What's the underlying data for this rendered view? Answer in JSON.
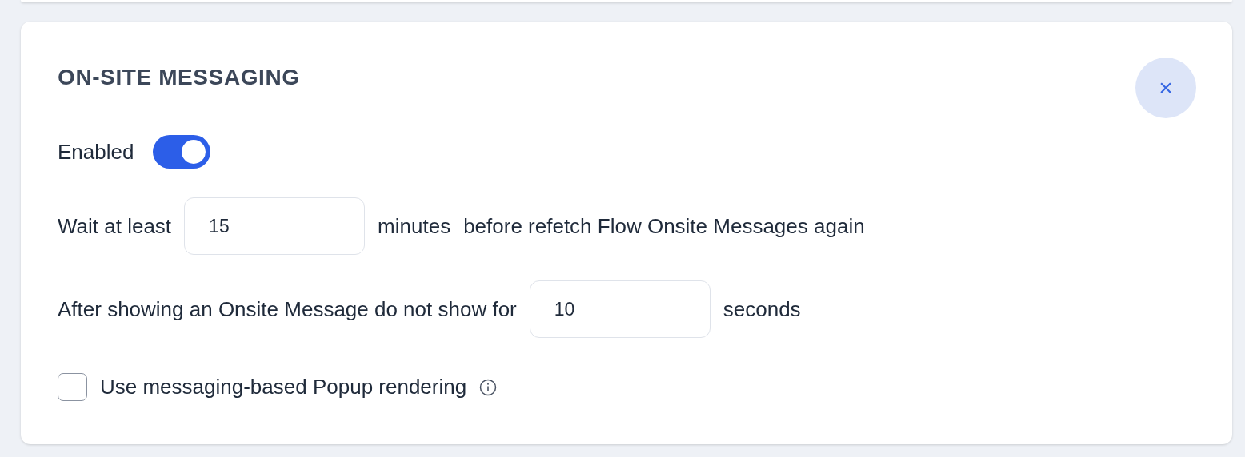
{
  "title": "ON-SITE MESSAGING",
  "close_button": {
    "label": "×"
  },
  "enabled": {
    "label": "Enabled",
    "on": true
  },
  "settings": [
    {
      "before": "Wait at least",
      "value": "15",
      "after": [
        "minutes",
        "before refetch Flow Onsite Messages again"
      ]
    },
    {
      "before": "After showing an Onsite Message do not show for",
      "value": "10",
      "after": [
        "seconds"
      ]
    }
  ],
  "popup_rendering": {
    "label": "Use messaging-based Popup rendering",
    "checked": false
  }
}
